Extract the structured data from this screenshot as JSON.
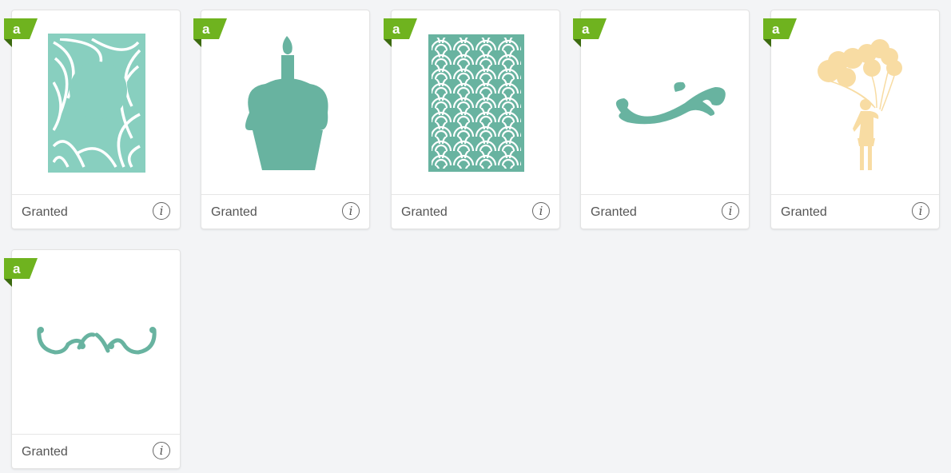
{
  "colors": {
    "teal_light": "#88cfbf",
    "teal": "#68b3a0",
    "peach": "#f8dca3",
    "badge_green": "#6fb31f",
    "badge_dark": "#3d6b10"
  },
  "badge": {
    "letter": "a",
    "icon": "access-badge-icon"
  },
  "cards": [
    {
      "status": "Granted",
      "image": "swirl-frame-card",
      "info_icon": "info-icon"
    },
    {
      "status": "Granted",
      "image": "cupcake-candle",
      "info_icon": "info-icon"
    },
    {
      "status": "Granted",
      "image": "scallop-pattern-card",
      "info_icon": "info-icon"
    },
    {
      "status": "Granted",
      "image": "flourish-swirl",
      "info_icon": "info-icon"
    },
    {
      "status": "Granted",
      "image": "girl-with-balloons",
      "info_icon": "info-icon"
    },
    {
      "status": "Granted",
      "image": "ornamental-border",
      "info_icon": "info-icon"
    }
  ]
}
